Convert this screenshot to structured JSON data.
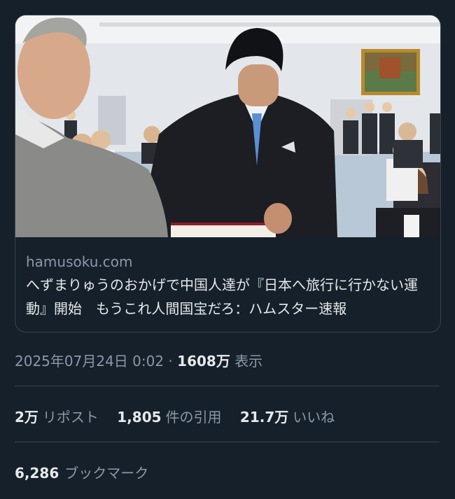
{
  "card": {
    "image_alt": "photo-ceremony",
    "domain": "hamusoku.com",
    "headline": "へずまりゅうのおかげで中国人達が『日本へ旅行に行かない運動』開始　もうこれ人間国宝だろ：ハムスター速報"
  },
  "meta": {
    "datetime": "2025年07月24日 0:02",
    "separator": " · ",
    "views_count": "1608万",
    "views_label": "表示"
  },
  "stats": {
    "reposts_count": "2万",
    "reposts_label": "リポスト",
    "quotes_count": "1,805",
    "quotes_label": "件の引用",
    "likes_count": "21.7万",
    "likes_label": "いいね"
  },
  "bookmarks": {
    "count": "6,286",
    "label": "ブックマーク"
  }
}
